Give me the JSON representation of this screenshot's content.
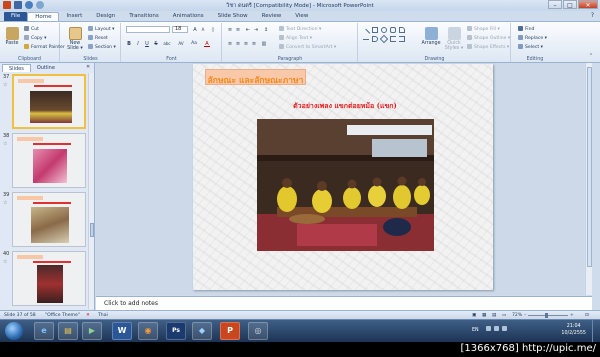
{
  "window": {
    "title": "วิชา ดนตรี [Compatibility Mode] - Microsoft PowerPoint",
    "minimize": "–",
    "maximize": "□",
    "close": "✕"
  },
  "tabs": [
    {
      "label": "File"
    },
    {
      "label": "Home"
    },
    {
      "label": "Insert"
    },
    {
      "label": "Design"
    },
    {
      "label": "Transitions"
    },
    {
      "label": "Animations"
    },
    {
      "label": "Slide Show"
    },
    {
      "label": "Review"
    },
    {
      "label": "View"
    }
  ],
  "help_icon": "?",
  "ribbon": {
    "clipboard": {
      "group": "Clipboard",
      "paste": "Paste",
      "cut": "Cut",
      "copy": "Copy ▾",
      "format_painter": "Format Painter"
    },
    "slides": {
      "group": "Slides",
      "new_slide": "New Slide ▾",
      "layout": "Layout ▾",
      "reset": "Reset",
      "section": "Section ▾"
    },
    "font": {
      "group": "Font",
      "font_size": "18",
      "bold": "B",
      "italic": "I",
      "underline": "U",
      "strike": "S",
      "shadow": "abc",
      "spacing": "AV",
      "case": "Aa",
      "color": "A"
    },
    "paragraph": {
      "group": "Paragraph",
      "text_direction": "Text Direction ▾",
      "align_text": "Align Text ▾",
      "smartart": "Convert to SmartArt ▾"
    },
    "drawing": {
      "group": "Drawing",
      "arrange": "Arrange",
      "quick_styles": "Quick Styles ▾",
      "shape_fill": "Shape Fill ▾",
      "shape_outline": "Shape Outline ▾",
      "shape_effects": "Shape Effects ▾"
    },
    "editing": {
      "group": "Editing",
      "find": "Find",
      "replace": "Replace ▾",
      "select": "Select ▾"
    }
  },
  "panel": {
    "tab_slides": "Slides",
    "tab_outline": "Outline",
    "close": "✕",
    "thumbnails": [
      {
        "num": "37",
        "star": "☆"
      },
      {
        "num": "38",
        "star": "☆"
      },
      {
        "num": "39",
        "star": "☆"
      },
      {
        "num": "40",
        "star": "☆"
      }
    ]
  },
  "slide": {
    "title": "ลักษณะ และลักษณะภาษา",
    "caption": "ตัวอย่างเพลง แขกต่อยหม้อ (แขก)"
  },
  "notes": {
    "placeholder": "Click to add notes"
  },
  "status": {
    "slide_count": "Slide 37 of 58",
    "theme": "\"Office Theme\"",
    "language": "Thai",
    "zoom": "72%",
    "zoom_minus": "–",
    "zoom_plus": "+"
  },
  "taskbar": {
    "apps": [
      {
        "label": "e",
        "color": "#2a8ad8"
      },
      {
        "label": "▤",
        "color": "#d9a72c"
      },
      {
        "label": "▶",
        "color": "#3c8a3c"
      },
      {
        "label": "W",
        "color": "#2b5797"
      },
      {
        "label": "◉",
        "color": "#e06a1c"
      },
      {
        "label": "Ps",
        "color": "#1b3a6e"
      },
      {
        "label": "◆",
        "color": "#3b7ec9"
      },
      {
        "label": "P",
        "color": "#c9461f"
      },
      {
        "label": "◎",
        "color": "#6d6d6d"
      }
    ],
    "language": "EN",
    "time": "21:04",
    "date": "10/2/2555"
  },
  "watermark": "[1366x768] http://upic.me/"
}
